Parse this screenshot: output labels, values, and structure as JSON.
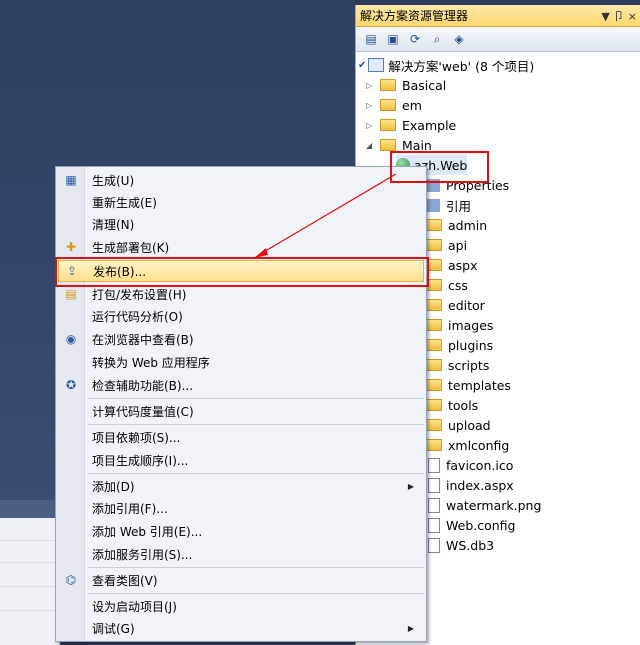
{
  "solution_explorer": {
    "title": "解决方案资源管理器",
    "pin_glyph": "▼ 卩 ×",
    "toolbar_icons": [
      "properties-icon",
      "show-all-files-icon",
      "refresh-icon",
      "view-designer-icon",
      "class-view-icon"
    ],
    "solution_label": "解决方案'web' (8 个项目)",
    "projects": [
      {
        "label": "Basical"
      },
      {
        "label": "em"
      },
      {
        "label": "Example"
      },
      {
        "label": "Main"
      }
    ],
    "web_project": "azh.Web",
    "children": [
      "Properties",
      "引用",
      "admin",
      "api",
      "aspx",
      "css",
      "editor",
      "images",
      "plugins",
      "scripts",
      "templates",
      "tools",
      "upload",
      "xmlconfig",
      "favicon.ico",
      "index.aspx",
      "watermark.png",
      "Web.config",
      "WS.db3"
    ]
  },
  "context_menu": {
    "items": [
      {
        "label": "生成(U)",
        "icon": "build-icon"
      },
      {
        "label": "重新生成(E)",
        "icon": ""
      },
      {
        "label": "清理(N)",
        "icon": ""
      },
      {
        "label": "生成部署包(K)",
        "icon": "deploy-package-icon"
      },
      {
        "label": "发布(B)...",
        "icon": "publish-icon"
      },
      {
        "label": "打包/发布设置(H)",
        "icon": "package-settings-icon"
      },
      {
        "label": "运行代码分析(O)",
        "icon": ""
      },
      {
        "label": "在浏览器中查看(B)",
        "icon": "browser-icon"
      },
      {
        "label": "转换为 Web 应用程序",
        "icon": ""
      },
      {
        "label": "检查辅助功能(B)...",
        "icon": "accessibility-icon"
      },
      {
        "label": "计算代码度量值(C)",
        "icon": ""
      },
      {
        "label": "项目依赖项(S)...",
        "icon": ""
      },
      {
        "label": "项目生成顺序(I)...",
        "icon": ""
      },
      {
        "label": "添加(D)",
        "icon": ""
      },
      {
        "label": "添加引用(F)...",
        "icon": ""
      },
      {
        "label": "添加 Web 引用(E)...",
        "icon": ""
      },
      {
        "label": "添加服务引用(S)...",
        "icon": ""
      },
      {
        "label": "查看类图(V)",
        "icon": "class-diagram-icon"
      },
      {
        "label": "设为启动项目(J)",
        "icon": ""
      },
      {
        "label": "调试(G)",
        "icon": ""
      }
    ]
  }
}
